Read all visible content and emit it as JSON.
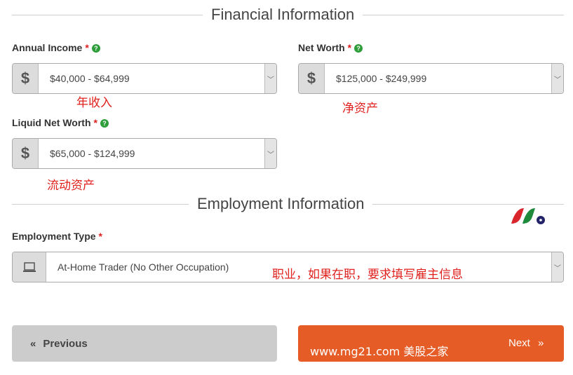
{
  "sections": {
    "financial_title": "Financial Information",
    "employment_title": "Employment Information"
  },
  "fields": {
    "annual_income": {
      "label": "Annual Income",
      "required": "*",
      "help_icon": "question-circle-icon",
      "addon_icon": "$",
      "value": "$40,000 - $64,999",
      "annotation": "年收入"
    },
    "net_worth": {
      "label": "Net Worth",
      "required": "*",
      "help_icon": "question-circle-icon",
      "addon_icon": "$",
      "value": "$125,000 - $249,999",
      "annotation": "净资产"
    },
    "liquid_net_worth": {
      "label": "Liquid Net Worth",
      "required": "*",
      "help_icon": "question-circle-icon",
      "addon_icon": "$",
      "value": "$65,000 - $124,999",
      "annotation": "流动资产"
    },
    "employment_type": {
      "label": "Employment Type",
      "required": "*",
      "addon_icon": "laptop-icon",
      "value": "At-Home Trader (No Other Occupation)",
      "annotation": "职业，如果在职，要求填写雇主信息"
    }
  },
  "help_glyph": "?",
  "caret_glyph": "﹀",
  "buttons": {
    "previous": {
      "icon": "«",
      "label": "Previous"
    },
    "next": {
      "label": "Next",
      "icon": "»"
    }
  },
  "watermark": "www.mg21.com 美股之家",
  "colors": {
    "accent_next": "#e55c26",
    "previous_bg": "#cccccc",
    "required": "#e02020",
    "help": "#2e9e3a",
    "annotation": "#e0201c"
  }
}
